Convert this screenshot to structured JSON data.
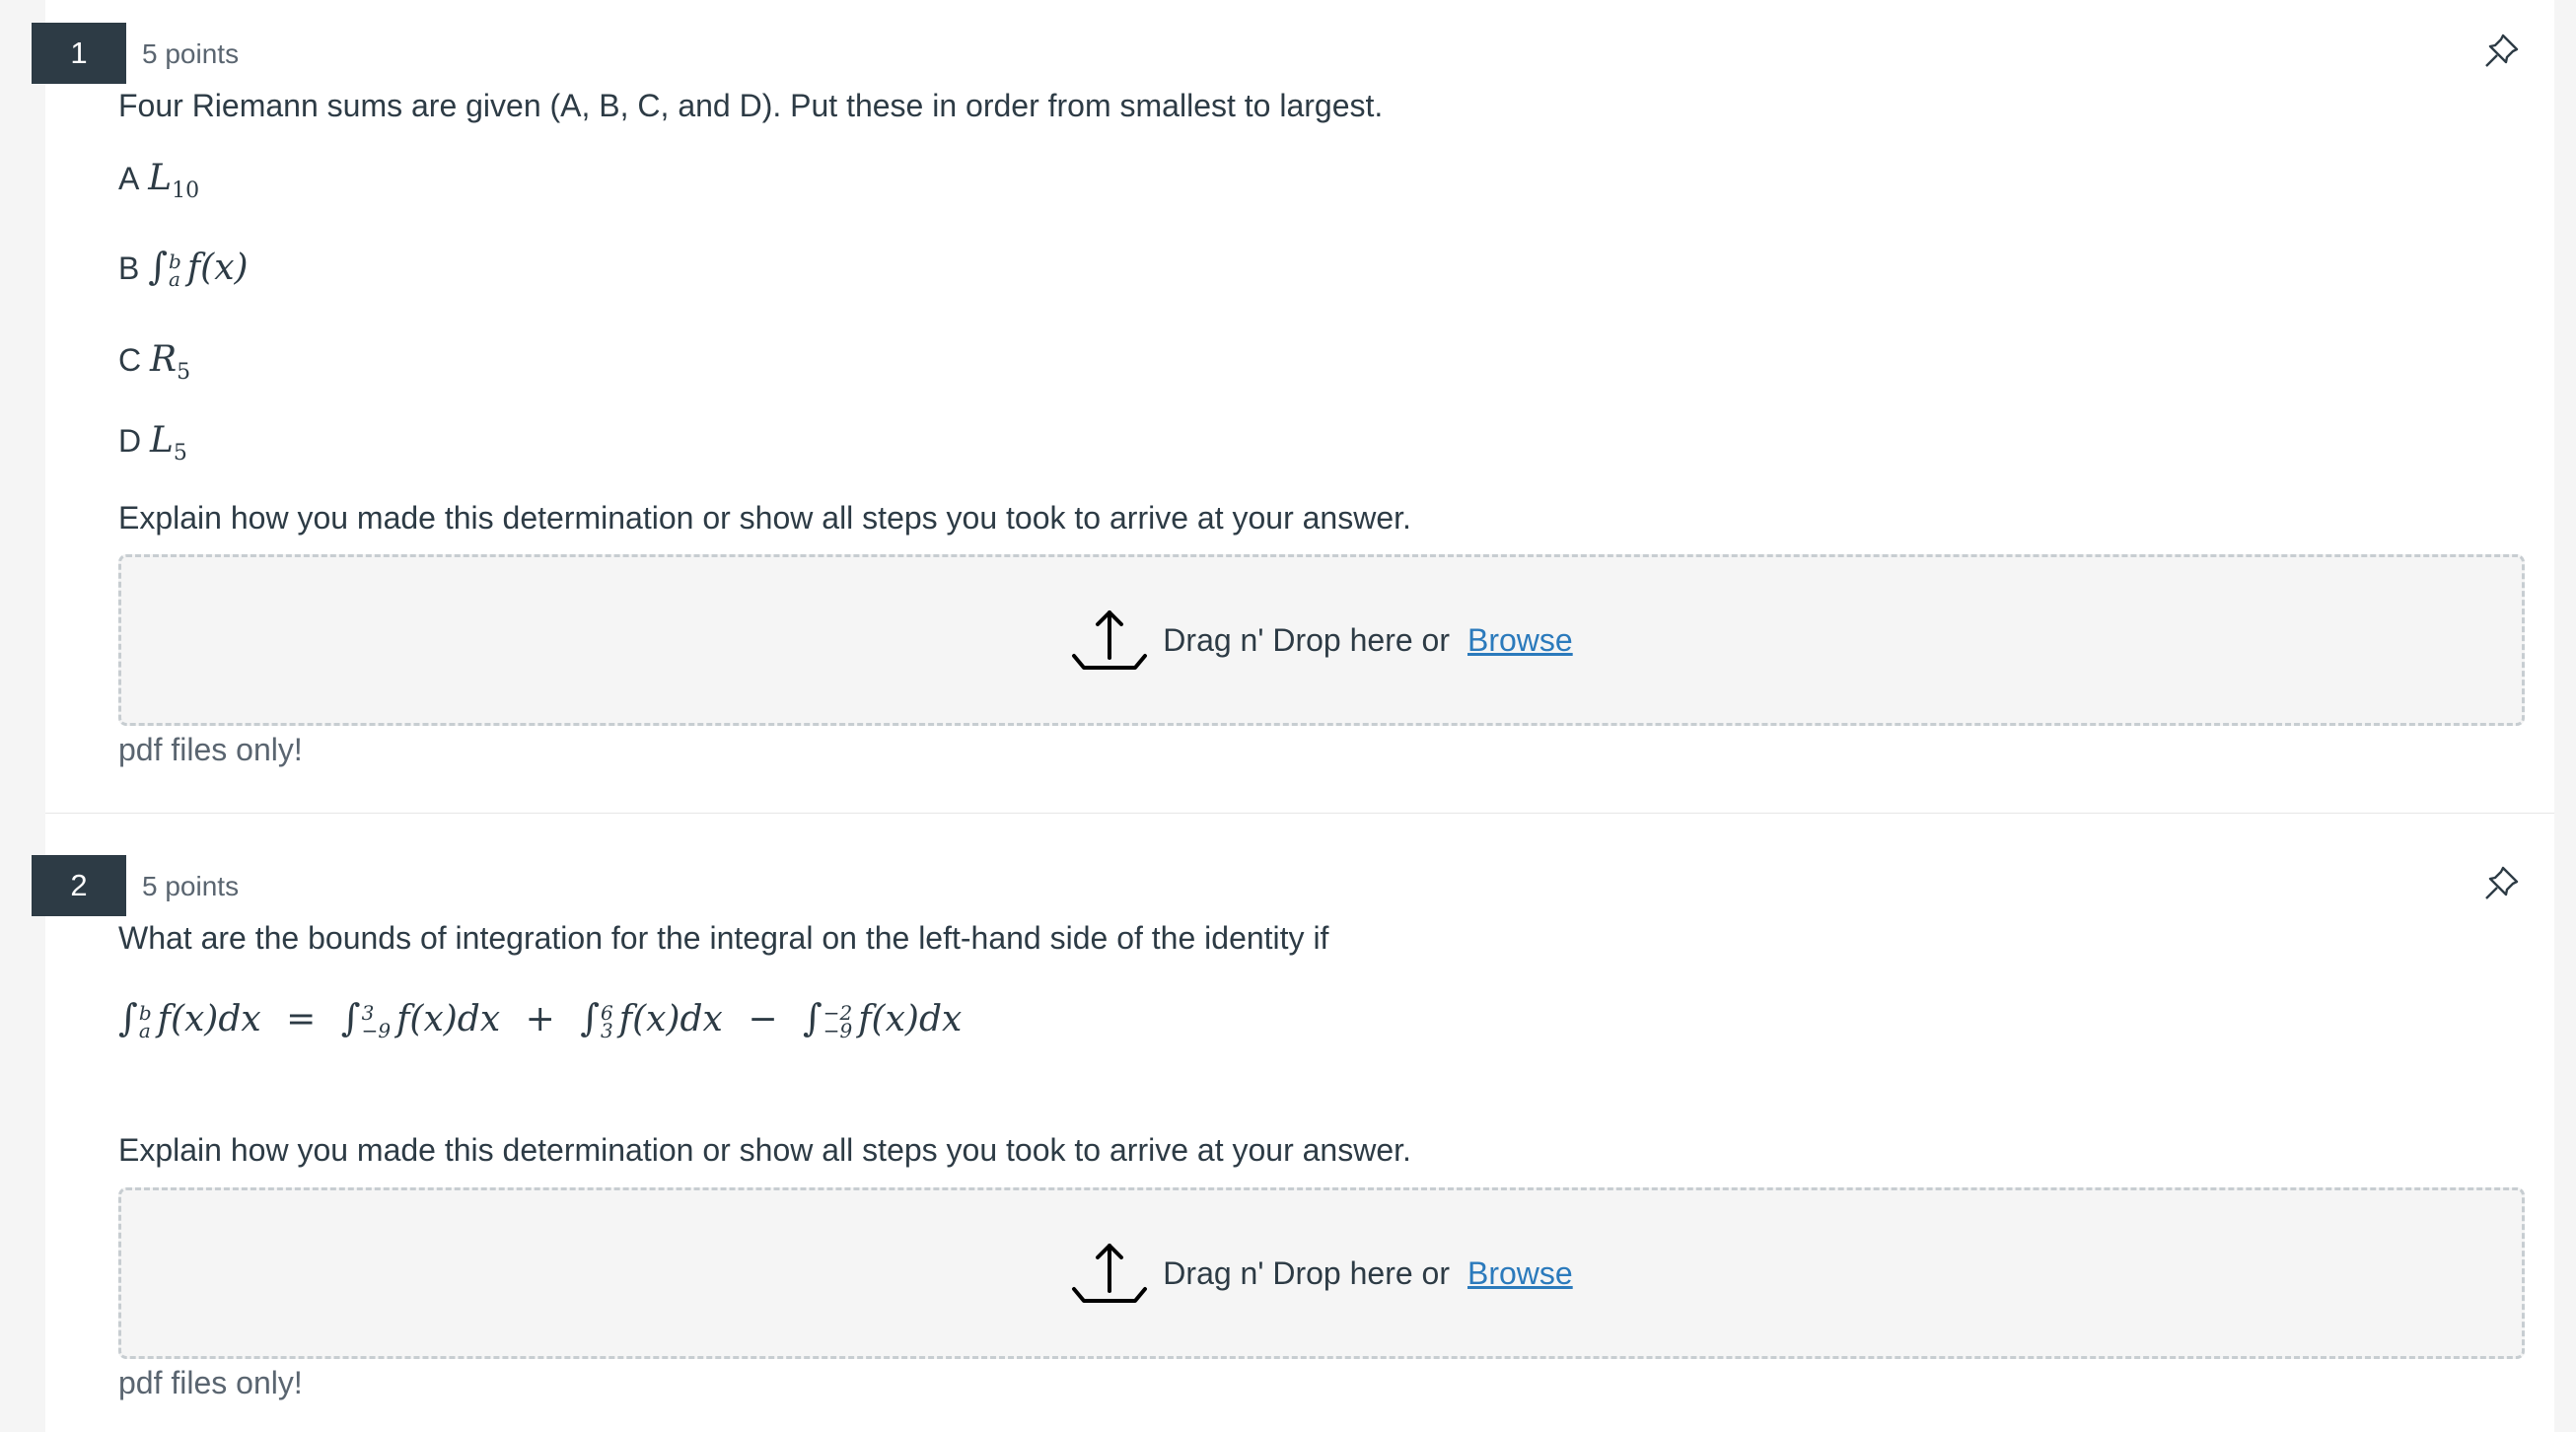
{
  "questions": [
    {
      "number": "1",
      "points": "5 points",
      "prompt": "Four Riemann sums are given (A, B, C, and D). Put these in order from smallest to largest.",
      "options": [
        {
          "letter": "A",
          "base": "L",
          "sub": "10"
        },
        {
          "letter": "B",
          "integral_lower": "a",
          "integral_upper": "b",
          "integrand": "f(x)"
        },
        {
          "letter": "C",
          "base": "R",
          "sub": "5"
        },
        {
          "letter": "D",
          "base": "L",
          "sub": "5"
        }
      ],
      "explain": "Explain how you made this determination or show all steps you took to arrive at your answer.",
      "upload": {
        "text": "Drag n' Drop here or",
        "browse": "Browse",
        "note": "pdf files only!"
      }
    },
    {
      "number": "2",
      "points": "5 points",
      "prompt": "What are the bounds of integration for the integral on the left-hand side of the identity if",
      "identity": {
        "lhs": {
          "lower": "a",
          "upper": "b",
          "integrand": "f(x)dx"
        },
        "eq": "=",
        "t1": {
          "lower": "−9",
          "upper": "3",
          "integrand": "f(x)dx"
        },
        "op1": "+",
        "t2": {
          "lower": "3",
          "upper": "6",
          "integrand": "f(x)dx"
        },
        "op2": "−",
        "t3": {
          "lower": "−9",
          "upper": "−2",
          "integrand": "f(x)dx"
        }
      },
      "explain": "Explain how you made this determination or show all steps you took to arrive at your answer.",
      "upload": {
        "text": "Drag n' Drop here or",
        "browse": "Browse",
        "note": "pdf files only!"
      }
    }
  ],
  "icons": {
    "pin": "pin-icon",
    "upload": "upload-icon"
  },
  "colors": {
    "badge": "#2d3b45",
    "link": "#2b7abc",
    "dropzone_border": "#c7cdd1"
  }
}
